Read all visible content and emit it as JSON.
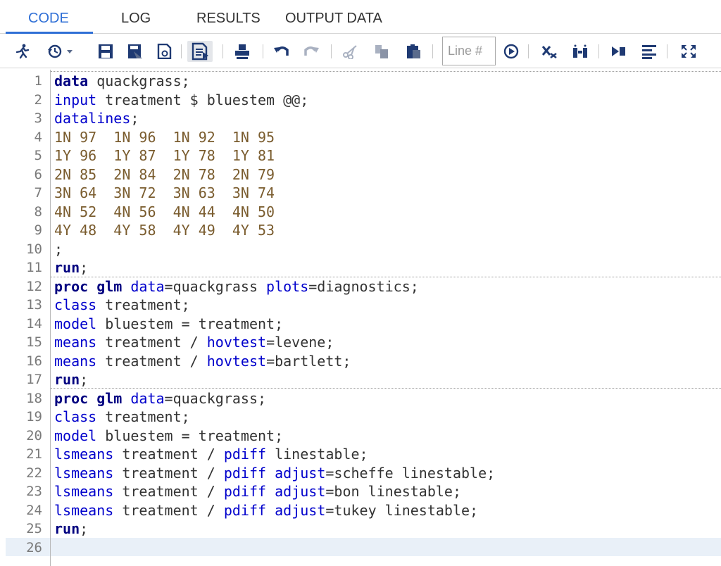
{
  "tabs": [
    "CODE",
    "LOG",
    "RESULTS",
    "OUTPUT DATA"
  ],
  "toolbar": {
    "line_placeholder": "Line #",
    "icons": [
      "run-icon",
      "history-icon",
      "save-icon",
      "save-as-icon",
      "open-icon",
      "format-icon",
      "print-icon",
      "undo-icon",
      "redo-icon",
      "cut-icon",
      "copy-icon",
      "paste-icon",
      "go-to-line-icon",
      "clear-icon",
      "snippets-icon",
      "submit-icon",
      "options-icon",
      "maximize-icon"
    ]
  },
  "colors": {
    "accent": "#2f6fd6",
    "keyword": "#000080",
    "statement": "#0000cc",
    "datalines": "#7a5c2e"
  },
  "editor": {
    "lines": [
      {
        "n": "1",
        "t": [
          [
            "kw",
            "data"
          ],
          [
            "tx",
            " quackgrass;"
          ]
        ]
      },
      {
        "n": "2",
        "t": [
          [
            "st",
            "input"
          ],
          [
            "tx",
            " treatment $ bluestem @@;"
          ]
        ]
      },
      {
        "n": "3",
        "t": [
          [
            "st",
            "datalines"
          ],
          [
            "tx",
            ";"
          ]
        ]
      },
      {
        "n": "4",
        "t": [
          [
            "dt",
            "1N 97  1N 96  1N 92  1N 95"
          ]
        ]
      },
      {
        "n": "5",
        "t": [
          [
            "dt",
            "1Y 96  1Y 87  1Y 78  1Y 81"
          ]
        ]
      },
      {
        "n": "6",
        "t": [
          [
            "dt",
            "2N 85  2N 84  2N 78  2N 79"
          ]
        ]
      },
      {
        "n": "7",
        "t": [
          [
            "dt",
            "3N 64  3N 72  3N 63  3N 74"
          ]
        ]
      },
      {
        "n": "8",
        "t": [
          [
            "dt",
            "4N 52  4N 56  4N 44  4N 50"
          ]
        ]
      },
      {
        "n": "9",
        "t": [
          [
            "dt",
            "4Y 48  4Y 58  4Y 49  4Y 53"
          ]
        ]
      },
      {
        "n": "10",
        "t": [
          [
            "tx",
            ";"
          ]
        ]
      },
      {
        "n": "11",
        "t": [
          [
            "kw",
            "run"
          ],
          [
            "tx",
            ";"
          ]
        ]
      },
      {
        "n": "12",
        "t": [
          [
            "kw",
            "proc glm"
          ],
          [
            "tx",
            " "
          ],
          [
            "opt",
            "data"
          ],
          [
            "tx",
            "=quackgrass "
          ],
          [
            "opt",
            "plots"
          ],
          [
            "tx",
            "=diagnostics;"
          ]
        ]
      },
      {
        "n": "13",
        "t": [
          [
            "st",
            "class"
          ],
          [
            "tx",
            " treatment;"
          ]
        ]
      },
      {
        "n": "14",
        "t": [
          [
            "st",
            "model"
          ],
          [
            "tx",
            " bluestem = treatment;"
          ]
        ]
      },
      {
        "n": "15",
        "t": [
          [
            "st",
            "means"
          ],
          [
            "tx",
            " treatment / "
          ],
          [
            "opt",
            "hovtest"
          ],
          [
            "tx",
            "=levene;"
          ]
        ]
      },
      {
        "n": "16",
        "t": [
          [
            "st",
            "means"
          ],
          [
            "tx",
            " treatment / "
          ],
          [
            "opt",
            "hovtest"
          ],
          [
            "tx",
            "=bartlett;"
          ]
        ]
      },
      {
        "n": "17",
        "t": [
          [
            "kw",
            "run"
          ],
          [
            "tx",
            ";"
          ]
        ]
      },
      {
        "n": "18",
        "t": [
          [
            "kw",
            "proc glm"
          ],
          [
            "tx",
            " "
          ],
          [
            "opt",
            "data"
          ],
          [
            "tx",
            "=quackgrass;"
          ]
        ]
      },
      {
        "n": "19",
        "t": [
          [
            "st",
            "class"
          ],
          [
            "tx",
            " treatment;"
          ]
        ]
      },
      {
        "n": "20",
        "t": [
          [
            "st",
            "model"
          ],
          [
            "tx",
            " bluestem = treatment;"
          ]
        ]
      },
      {
        "n": "21",
        "t": [
          [
            "st",
            "lsmeans"
          ],
          [
            "tx",
            " treatment / "
          ],
          [
            "opt",
            "pdiff"
          ],
          [
            "tx",
            " linestable;"
          ]
        ]
      },
      {
        "n": "22",
        "t": [
          [
            "st",
            "lsmeans"
          ],
          [
            "tx",
            " treatment / "
          ],
          [
            "opt",
            "pdiff"
          ],
          [
            "tx",
            " "
          ],
          [
            "opt",
            "adjust"
          ],
          [
            "tx",
            "=scheffe linestable;"
          ]
        ]
      },
      {
        "n": "23",
        "t": [
          [
            "st",
            "lsmeans"
          ],
          [
            "tx",
            " treatment / "
          ],
          [
            "opt",
            "pdiff"
          ],
          [
            "tx",
            " "
          ],
          [
            "opt",
            "adjust"
          ],
          [
            "tx",
            "=bon linestable;"
          ]
        ]
      },
      {
        "n": "24",
        "t": [
          [
            "st",
            "lsmeans"
          ],
          [
            "tx",
            " treatment / "
          ],
          [
            "opt",
            "pdiff"
          ],
          [
            "tx",
            " "
          ],
          [
            "opt",
            "adjust"
          ],
          [
            "tx",
            "=tukey linestable;"
          ]
        ]
      },
      {
        "n": "25",
        "t": [
          [
            "kw",
            "run"
          ],
          [
            "tx",
            ";"
          ]
        ]
      },
      {
        "n": "26",
        "t": []
      }
    ]
  }
}
